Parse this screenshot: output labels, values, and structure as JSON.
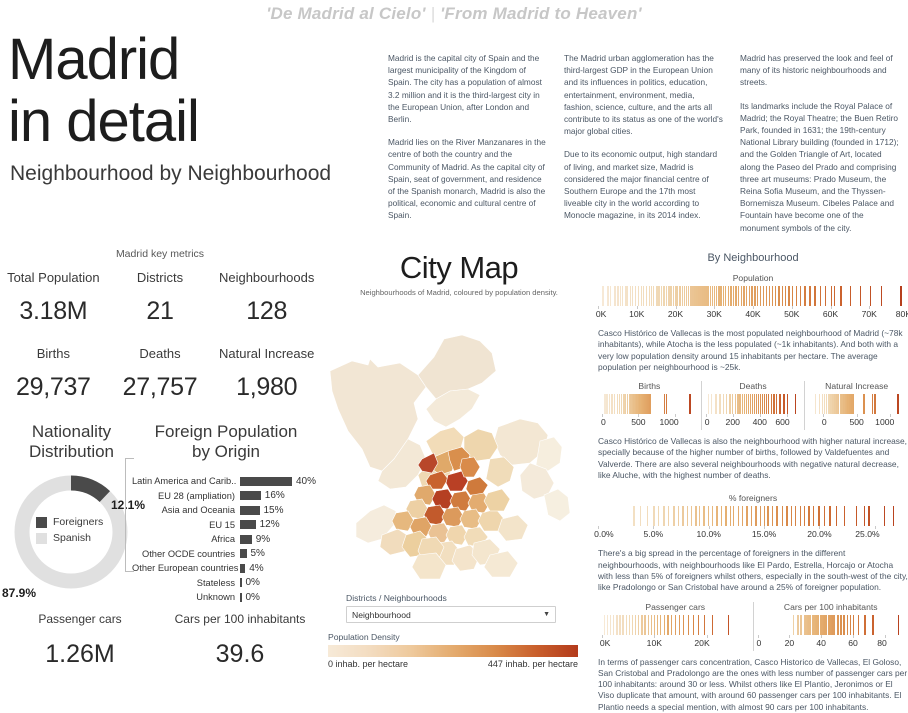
{
  "header": {
    "tagline_es": "'De Madrid al Cielo'",
    "tagline_sep": "|",
    "tagline_en": "'From Madrid to Heaven'",
    "title_line1": "Madrid",
    "title_line2": "in detail",
    "subtitle": "Neighbourhood by Neighbourhood"
  },
  "blurbs": [
    {
      "p1": "Madrid is the capital city of Spain and the largest municipality of the Kingdom of Spain. The city has a population of almost 3.2 million and it is the third-largest city in the European Union, after London and Berlin.",
      "p2": "Madrid lies on the River Manzanares in the centre of both the country and the Community of Madrid. As the capital city of Spain, seat of government, and residence of the Spanish monarch, Madrid is also the political, economic and cultural centre of Spain."
    },
    {
      "p1": "The Madrid urban agglomeration has the third-largest GDP in the European Union and its influences in politics, education, entertainment, environment, media, fashion, science, culture, and the arts all contribute to its status as one of the world's major global cities.",
      "p2": "Due to its economic output, high standard of living, and market size, Madrid is considered the major financial centre of Southern Europe and the 17th most liveable city in the world according to Monocle magazine, in its 2014 index."
    },
    {
      "p1": "Madrid has preserved the look and feel of many of its historic neighbourhoods and streets.",
      "p2": "Its landmarks include the Royal Palace of Madrid; the Royal Theatre; the Buen Retiro Park, founded in 1631; the 19th-century National Library building (founded in 1712); and the Golden Triangle of Art, located along the Paseo del Prado and comprising three art museums: Prado Museum, the Reina Sofia Museum, and the Thyssen-Bornemisza Museum. Cibeles Palace and Fountain have become one of the monument symbols of the city."
    }
  ],
  "key_metrics": {
    "section_title": "Madrid key metrics",
    "row1": [
      {
        "label": "Total Population",
        "value": "3.18M"
      },
      {
        "label": "Districts",
        "value": "21"
      },
      {
        "label": "Neighbourhoods",
        "value": "128"
      }
    ],
    "row2": [
      {
        "label": "Births",
        "value": "29,737"
      },
      {
        "label": "Deaths",
        "value": "27,757"
      },
      {
        "label": "Natural Increase",
        "value": "1,980"
      }
    ]
  },
  "nationality": {
    "title_line1": "Nationality",
    "title_line2": "Distribution",
    "foreign_pct_label": "12.1%",
    "spanish_pct_label": "87.9%",
    "legend": [
      {
        "label": "Foreigners",
        "color": "#4a4a4a"
      },
      {
        "label": "Spanish",
        "color": "#e0e0e0"
      }
    ]
  },
  "foreign_population": {
    "title_line1": "Foreign Population",
    "title_line2": "by Origin",
    "bar_color": "#4a4a4a",
    "rows": [
      {
        "name": "Latin America and Carib..",
        "pct": "40%",
        "value": 40
      },
      {
        "name": "EU 28 (ampliation)",
        "pct": "16%",
        "value": 16
      },
      {
        "name": "Asia and Oceania",
        "pct": "15%",
        "value": 15
      },
      {
        "name": "EU 15",
        "pct": "12%",
        "value": 12
      },
      {
        "name": "Africa",
        "pct": "9%",
        "value": 9
      },
      {
        "name": "Other OCDE countries",
        "pct": "5%",
        "value": 5
      },
      {
        "name": "Other European countries",
        "pct": "4%",
        "value": 4
      },
      {
        "name": "Stateless",
        "pct": "0%",
        "value": 0
      },
      {
        "name": "Unknown",
        "pct": "0%",
        "value": 0
      }
    ]
  },
  "cars": [
    {
      "label": "Passenger cars",
      "value": "1.26M"
    },
    {
      "label": "Cars per 100 inhabitants",
      "value": "39.6"
    }
  ],
  "map": {
    "title": "City Map",
    "subtitle": "Neighbourhoods of Madrid, coloured by population density.",
    "dropdown_label": "Districts / Neighbourhoods",
    "dropdown_value": "Neighbourhood",
    "dropdown_caret": "chevron-down-icon",
    "legend_title": "Population Density",
    "legend_min": "0 inhab. per hectare",
    "legend_max": "447 inhab. per hectare",
    "legend_colors": [
      "#f7ead8",
      "#eec99c",
      "#e4ab6e",
      "#d98b4a",
      "#c95f2c",
      "#b33a1b"
    ]
  },
  "by_neighbourhood": {
    "heading": "By Neighbourhood",
    "population": {
      "title": "Population",
      "ticks": [
        "0K",
        "10K",
        "20K",
        "30K",
        "40K",
        "50K",
        "60K",
        "70K",
        "80K"
      ],
      "note": "Casco Histórico de Vallecas is the most populated neighbourhood of Madrid (~78k inhabitants), while Atocha is the less populated (~1k inhabitants). And both with a very low population density around 15 inhabitants per hectare. The average population per neighbourhood is ~25k."
    },
    "vitals": {
      "cells": [
        {
          "title": "Births",
          "ticks": [
            "0",
            "500",
            "1000"
          ]
        },
        {
          "title": "Deaths",
          "ticks": [
            "0",
            "200",
            "400",
            "600"
          ]
        },
        {
          "title": "Natural Increase",
          "ticks": [
            "0",
            "500",
            "1000"
          ]
        }
      ],
      "note": "Casco Histórico de Vallecas is also the neighbourhood with higher natural increase, specially because of the higher number of births, followed by Valdefuentes and Valverde. There are also several neighbourhoods with negative natural decrease, like Aluche, with the highest number of deaths."
    },
    "foreigners": {
      "title": "% foreigners",
      "ticks": [
        "0.0%",
        "5.0%",
        "10.0%",
        "15.0%",
        "20.0%",
        "25.0%"
      ],
      "note": "There's a big spread in the percentage of foreigners in the different neighbourhoods, with neighbourhoods like El Pardo, Estrella, Horcajo or Atocha with less than 5% of foreigners whilst others, especially in the south-west of the city, like Pradolongo or San Cristobal have around a 25% of foreigner population."
    },
    "cars": {
      "cells": [
        {
          "title": "Passenger cars",
          "ticks": [
            "0K",
            "10K",
            "20K"
          ]
        },
        {
          "title": "Cars per 100 inhabitants",
          "ticks": [
            "0",
            "20",
            "40",
            "60",
            "80"
          ]
        }
      ],
      "note": "In terms of passenger cars concentration, Casco Historico de Vallecas, El Goloso, San Cristobal and Pradolongo are the ones with less number of passenger cars per 100 inhabitants: around 30 or less. Whilst others like El Plantio, Jeronimos or El Viso duplicate that amount, with around 60 passenger cars per 100 inhabitants. El Plantio needs a special mention, with almost 90 cars per 100 inhabitants."
    }
  },
  "chart_data": [
    {
      "type": "pie",
      "title": "Nationality Distribution",
      "categories": [
        "Foreigners",
        "Spanish"
      ],
      "values": [
        12.1,
        87.9
      ],
      "colors": [
        "#4a4a4a",
        "#e0e0e0"
      ]
    },
    {
      "type": "bar",
      "title": "Foreign Population by Origin",
      "categories": [
        "Latin America and Carib..",
        "EU 28 (ampliation)",
        "Asia and Oceania",
        "EU 15",
        "Africa",
        "Other OCDE countries",
        "Other European countries",
        "Stateless",
        "Unknown"
      ],
      "values": [
        40,
        16,
        15,
        12,
        9,
        5,
        4,
        0,
        0
      ],
      "xlabel": "",
      "ylabel": "",
      "xlim": [
        0,
        40
      ]
    },
    {
      "type": "scatter",
      "title": "Population",
      "xlabel": "Population",
      "xlim": [
        0,
        80000
      ],
      "tick_labels": [
        "0K",
        "10K",
        "20K",
        "30K",
        "40K",
        "50K",
        "60K",
        "70K",
        "80K"
      ],
      "x": [
        1100,
        2400,
        3100,
        4200,
        5000,
        5600,
        6200,
        7000,
        7400,
        8200,
        8800,
        9500,
        10200,
        11000,
        11600,
        12400,
        13100,
        13700,
        14200,
        15000,
        15600,
        16200,
        16900,
        17500,
        18100,
        18700,
        19300,
        19900,
        20400,
        21000,
        21600,
        22100,
        22700,
        23200,
        23800,
        24300,
        24900,
        25400,
        25900,
        26400,
        26900,
        27400,
        27900,
        28400,
        28900,
        29400,
        29900,
        30400,
        31000,
        31600,
        32200,
        32800,
        33500,
        34100,
        34800,
        35400,
        36100,
        36800,
        37500,
        38200,
        38900,
        39600,
        40300,
        41000,
        41800,
        42500,
        43300,
        44100,
        44900,
        45700,
        46500,
        47400,
        48200,
        49100,
        50000,
        51000,
        52000,
        53200,
        54500,
        55800,
        57200,
        58600,
        60100,
        60800,
        62500,
        65000,
        67500,
        70200,
        73000,
        78000
      ]
    },
    {
      "type": "scatter",
      "title": "Births",
      "xlim": [
        0,
        1300
      ],
      "tick_labels": [
        "0",
        "500",
        "1000"
      ],
      "x": [
        30,
        60,
        95,
        130,
        165,
        200,
        230,
        260,
        290,
        315,
        340,
        365,
        390,
        410,
        430,
        450,
        470,
        490,
        510,
        530,
        545,
        560,
        575,
        590,
        600,
        615,
        625,
        640,
        650,
        850,
        880,
        1200
      ]
    },
    {
      "type": "scatter",
      "title": "Deaths",
      "xlim": [
        0,
        700
      ],
      "tick_labels": [
        "0",
        "200",
        "400",
        "600"
      ],
      "x": [
        15,
        40,
        70,
        100,
        125,
        150,
        175,
        195,
        215,
        235,
        250,
        265,
        280,
        295,
        310,
        325,
        340,
        355,
        370,
        385,
        400,
        415,
        430,
        445,
        460,
        480,
        500,
        520,
        545,
        575,
        600,
        660
      ]
    },
    {
      "type": "scatter",
      "title": "Natural Increase",
      "xlim": [
        -200,
        1200
      ],
      "tick_labels": [
        "0",
        "500",
        "1000"
      ],
      "x": [
        -120,
        -60,
        -20,
        10,
        45,
        80,
        110,
        140,
        170,
        200,
        225,
        250,
        275,
        300,
        320,
        340,
        360,
        380,
        400,
        420,
        440,
        600,
        720,
        760,
        1100
      ]
    },
    {
      "type": "scatter",
      "title": "% foreigners",
      "xlim": [
        0,
        28
      ],
      "tick_labels": [
        "0.0%",
        "5.0%",
        "10.0%",
        "15.0%",
        "20.0%",
        "25.0%"
      ],
      "x": [
        3.2,
        3.8,
        4.4,
        5.0,
        5.4,
        5.9,
        6.3,
        6.8,
        7.2,
        7.6,
        8.0,
        8.4,
        8.8,
        9.1,
        9.5,
        9.9,
        10.3,
        10.7,
        11.1,
        11.5,
        11.9,
        12.2,
        12.6,
        13.0,
        13.4,
        13.8,
        14.2,
        14.6,
        15.0,
        15.3,
        15.7,
        16.1,
        16.6,
        17.0,
        17.4,
        17.8,
        18.2,
        18.6,
        19.0,
        19.4,
        19.9,
        20.4,
        20.9,
        21.5,
        22.2,
        23.3,
        24.0,
        24.4,
        25.8,
        26.6
      ]
    },
    {
      "type": "scatter",
      "title": "Passenger cars",
      "xlim": [
        0,
        28000
      ],
      "tick_labels": [
        "0K",
        "10K",
        "20K"
      ],
      "x": [
        400,
        900,
        1500,
        2100,
        2700,
        3300,
        3900,
        4500,
        5100,
        5700,
        6300,
        6900,
        7500,
        8100,
        8700,
        9300,
        9900,
        10500,
        11100,
        11800,
        12500,
        13200,
        13900,
        14700,
        15500,
        16400,
        17300,
        18300,
        19500,
        21000,
        24000
      ]
    },
    {
      "type": "scatter",
      "title": "Cars per 100 inhabitants",
      "xlim": [
        0,
        92
      ],
      "tick_labels": [
        "0",
        "20",
        "40",
        "60",
        "80"
      ],
      "x": [
        22,
        25,
        27,
        29,
        30,
        31,
        32,
        33,
        34,
        35,
        36,
        37,
        38,
        39,
        40,
        41,
        42,
        43,
        44,
        45,
        46,
        47,
        48,
        50,
        52,
        54,
        56,
        58,
        60,
        63,
        67,
        72,
        88
      ]
    }
  ]
}
